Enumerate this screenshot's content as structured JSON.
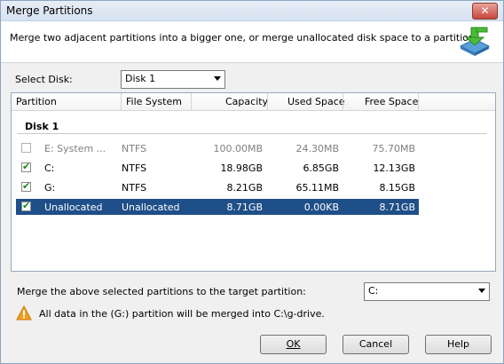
{
  "window": {
    "title": "Merge Partitions",
    "close_glyph": "✕"
  },
  "header": {
    "description": "Merge two adjacent partitions into a bigger one, or merge unallocated disk space to a partition."
  },
  "disk_select": {
    "label": "Select Disk:",
    "value": "Disk 1"
  },
  "table": {
    "columns": [
      "Partition",
      "File System",
      "Capacity",
      "Used Space",
      "Free Space"
    ],
    "group": "Disk 1",
    "rows": [
      {
        "checked": false,
        "partition": "E: System ...",
        "fs": "NTFS",
        "capacity": "100.00MB",
        "used": "24.30MB",
        "free": "75.70MB",
        "disabled": true,
        "selected": false
      },
      {
        "checked": true,
        "partition": "C:",
        "fs": "NTFS",
        "capacity": "18.98GB",
        "used": "6.85GB",
        "free": "12.13GB",
        "disabled": false,
        "selected": false
      },
      {
        "checked": true,
        "partition": "G:",
        "fs": "NTFS",
        "capacity": "8.21GB",
        "used": "65.11MB",
        "free": "8.15GB",
        "disabled": false,
        "selected": false
      },
      {
        "checked": true,
        "partition": "Unallocated",
        "fs": "Unallocated",
        "capacity": "8.71GB",
        "used": "0.00KB",
        "free": "8.71GB",
        "disabled": false,
        "selected": true
      }
    ]
  },
  "target": {
    "label": "Merge the above selected partitions to the target partition:",
    "value": "C:"
  },
  "warning": {
    "text": "All data in the (G:) partition will be merged into C:\\g-drive."
  },
  "buttons": {
    "ok": "OK",
    "cancel": "Cancel",
    "help": "Help"
  },
  "colors": {
    "selection": "#1f4f88",
    "check": "#1a8a1a",
    "warning": "#f0a020"
  }
}
